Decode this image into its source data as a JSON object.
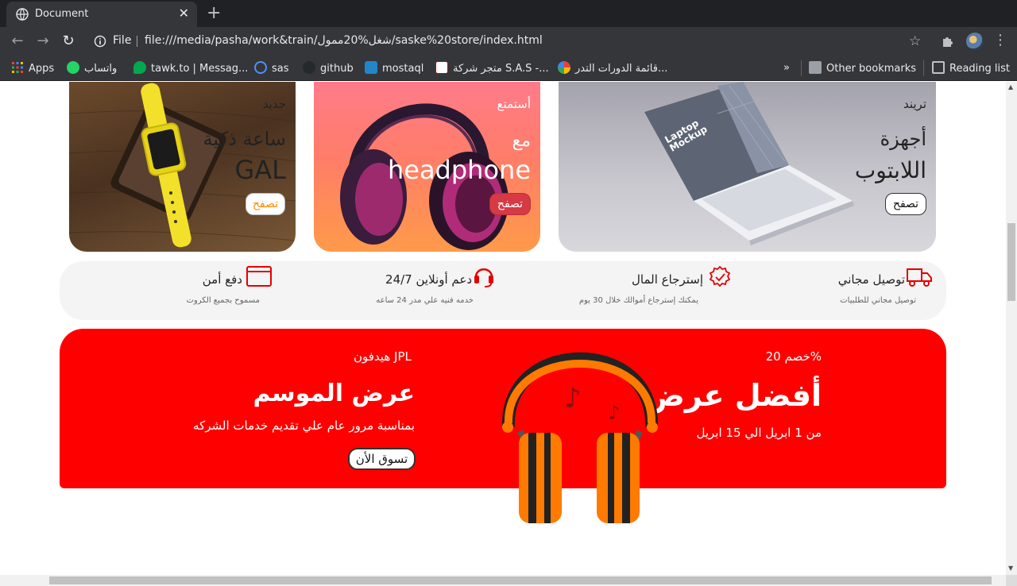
{
  "browser": {
    "tab_title": "Document",
    "url_scheme_label": "File",
    "url": "file:///media/pasha/work&train/شغل%20ممول/saske%20store/index.html",
    "bookmarks": [
      {
        "label": "Apps",
        "icon": "apps-grid-icon"
      },
      {
        "label": "واتساب",
        "icon": "whatsapp-icon"
      },
      {
        "label": "tawk.to | Messag...",
        "icon": "tawkto-icon"
      },
      {
        "label": "sas",
        "icon": "play-icon"
      },
      {
        "label": "github",
        "icon": "github-icon"
      },
      {
        "label": "mostaql",
        "icon": "mostaql-icon"
      },
      {
        "label": "متجر شركة S.A.S -...",
        "icon": "sas-store-icon"
      },
      {
        "label": "قائمة الدورات التدر...",
        "icon": "google-icon"
      }
    ],
    "overflow_label": "»",
    "other_bookmarks": "Other bookmarks",
    "reading_list": "Reading list"
  },
  "cards": {
    "watch": {
      "tag": "جديد",
      "line1": "ساعة ذكية",
      "line2": "GAL",
      "button": "تصفح"
    },
    "headphone": {
      "tag": "أستمتع",
      "line1": "مع",
      "line2": "headphone",
      "button": "تصفح"
    },
    "laptop": {
      "tag": "تريند",
      "line1": "أجهزة",
      "line2": "اللابتوب",
      "button": "تصفح",
      "image_text": "Laptop Mockup"
    }
  },
  "features": [
    {
      "title": "توصيل مجاني",
      "subtitle": "توصيل مجاني للطلبيات",
      "icon": "truck-icon"
    },
    {
      "title": "إسترجاع المال",
      "subtitle": "يمكنك إسترجاع أموالك خلال 30 يوم",
      "icon": "badge-check-icon"
    },
    {
      "title": "دعم أونلاين 24/7",
      "subtitle": "خدمه فنيه علي مدر 24 ساعه",
      "icon": "headset-icon"
    },
    {
      "title": "دفع أمن",
      "subtitle": "مسموح بجميع الكروت",
      "icon": "card-icon"
    }
  ],
  "banner": {
    "discount": "خصم 20%",
    "headline": "أفضل عرض",
    "dates": "من 1 ابريل الي 15 ابريل",
    "product": "هيدفون JPL",
    "season_title": "عرض الموسم",
    "season_desc": "بمناسبة مرور عام علي تقديم خدمات الشركه",
    "cta": "تسوق الأن"
  },
  "colors": {
    "accent_red": "#ff0000",
    "orange": "#ff7a00"
  }
}
